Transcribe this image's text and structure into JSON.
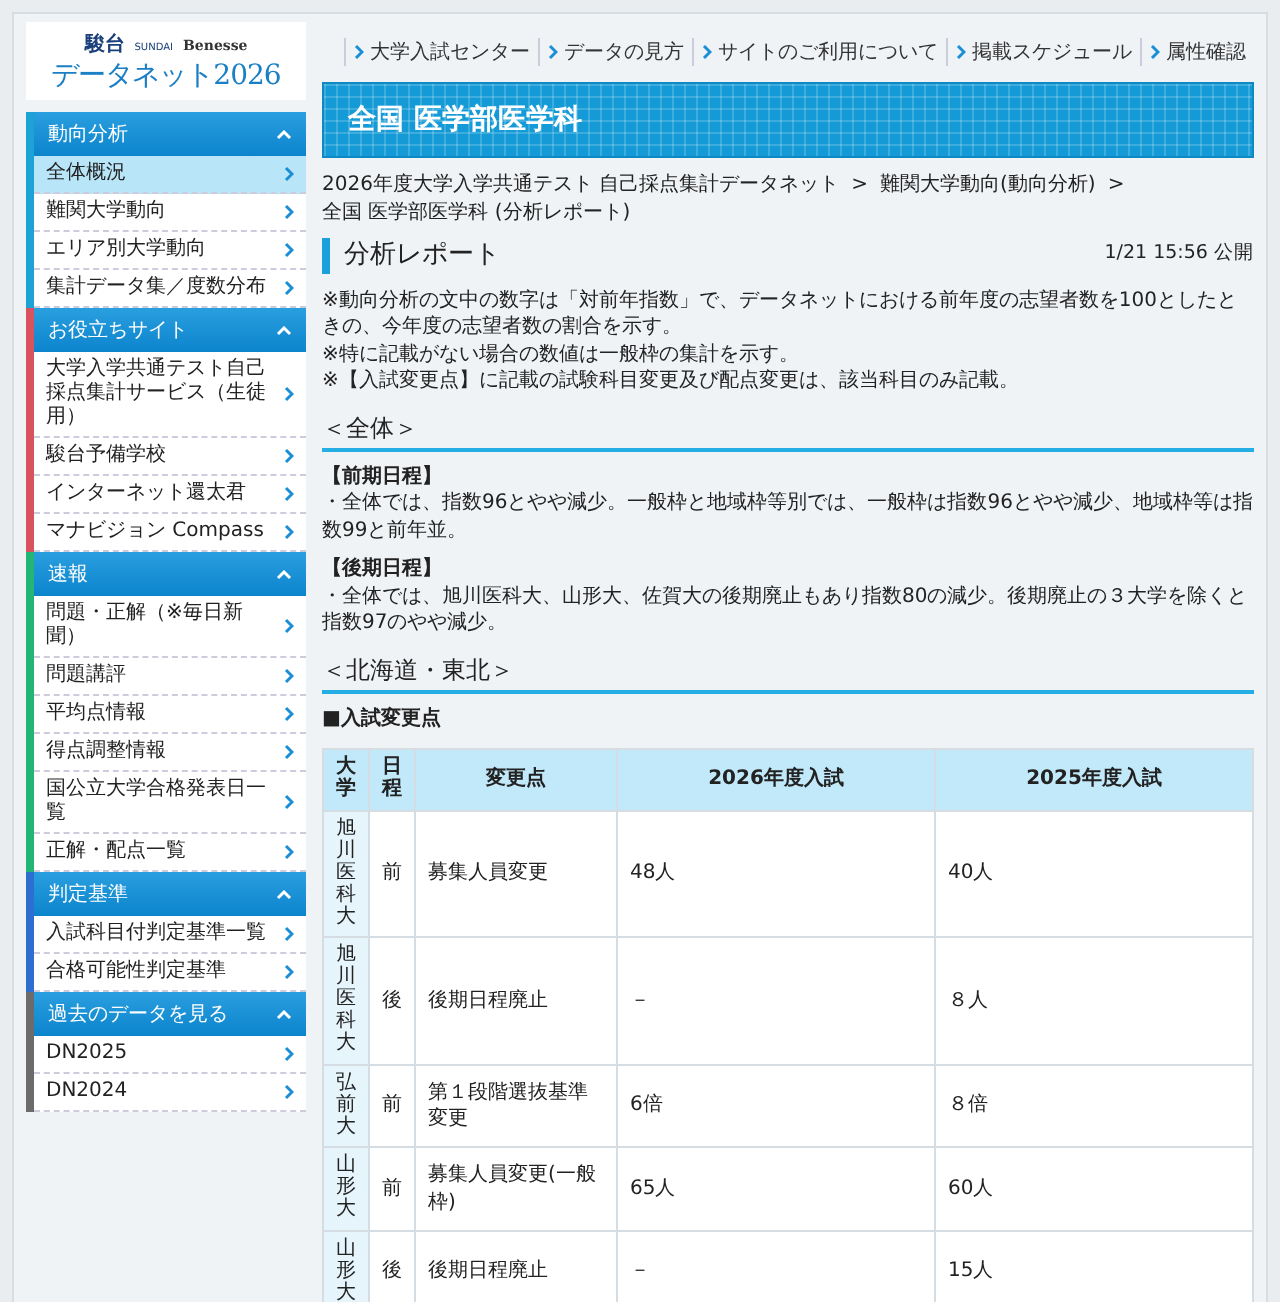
{
  "logo": {
    "brand": "駿台",
    "brand_sub": "SUNDAI",
    "partner": "Benesse",
    "title": "データネット2026"
  },
  "top_nav": [
    "大学入試センター",
    "データの見方",
    "サイトのご利用について",
    "掲載スケジュール",
    "属性確認"
  ],
  "sidebar": {
    "sections": [
      {
        "title": "動向分析",
        "color": "#1ba3d6",
        "expanded": true,
        "items": [
          {
            "label": "全体概況",
            "selected": true
          },
          {
            "label": "難関大学動向",
            "selected": false
          },
          {
            "label": "エリア別大学動向",
            "selected": false
          },
          {
            "label": "集計データ集／度数分布",
            "selected": false
          }
        ]
      },
      {
        "title": "お役立ちサイト",
        "color": "#d9535e",
        "expanded": true,
        "items": [
          {
            "label": "大学入学共通テスト自己採点集計サービス（生徒用）",
            "selected": false
          },
          {
            "label": "駿台予備学校",
            "selected": false
          },
          {
            "label": "インターネット還太君",
            "selected": false
          },
          {
            "label": "マナビジョン Compass",
            "selected": false
          }
        ]
      },
      {
        "title": "速報",
        "color": "#22b573",
        "expanded": true,
        "items": [
          {
            "label": "問題・正解（※毎日新聞）",
            "selected": false
          },
          {
            "label": "問題講評",
            "selected": false
          },
          {
            "label": "平均点情報",
            "selected": false
          },
          {
            "label": "得点調整情報",
            "selected": false
          },
          {
            "label": "国公立大学合格発表日一覧",
            "selected": false
          },
          {
            "label": "正解・配点一覧",
            "selected": false
          }
        ]
      },
      {
        "title": "判定基準",
        "color": "#2c6fd1",
        "expanded": true,
        "items": [
          {
            "label": "入試科目付判定基準一覧",
            "selected": false
          },
          {
            "label": "合格可能性判定基準",
            "selected": false
          }
        ]
      },
      {
        "title": "過去のデータを見る",
        "color": "#6b6b6b",
        "expanded": true,
        "items": [
          {
            "label": "DN2025",
            "selected": false
          },
          {
            "label": "DN2024",
            "selected": false
          }
        ]
      }
    ]
  },
  "banner": {
    "title": "全国 医学部医学科"
  },
  "breadcrumb": {
    "separator": ">",
    "items": [
      "2026年度大学入学共通テスト 自己採点集計データネット",
      "難関大学動向(動向分析)",
      "全国 医学部医学科 (分析レポート)"
    ]
  },
  "report": {
    "title": "分析レポート",
    "published": "1/21 15:56 公開",
    "notes": [
      "※動向分析の文中の数字は「対前年指数」で、データネットにおける前年度の志望者数を100としたときの、今年度の志望者数の割合を示す。",
      "※特に記載がない場合の数値は一般枠の集計を示す。",
      "※【入試変更点】に記載の試験科目変更及び配点変更は、該当科目のみ記載。"
    ],
    "sections": [
      {
        "heading": "＜全体＞",
        "blocks": [
          {
            "kind": "text",
            "title": "【前期日程】",
            "text": "・全体では、指数96とやや減少。一般枠と地域枠等別では、一般枠は指数96とやや減少、地域枠等は指数99と前年並。"
          },
          {
            "kind": "text",
            "title": "【後期日程】",
            "text": "・全体では、旭川医科大、山形大、佐賀大の後期廃止もあり指数80の減少。後期廃止の３大学を除くと指数97のやや減少。"
          }
        ]
      },
      {
        "heading": "＜北海道・東北＞",
        "blocks": [
          {
            "kind": "table",
            "title": "■入試変更点",
            "columns": [
              "大学",
              "日程",
              "変更点",
              "2026年度入試",
              "2025年度入試"
            ],
            "rows": [
              [
                "旭川医科大",
                "前",
                "募集人員変更",
                "48人",
                "40人"
              ],
              [
                "旭川医科大",
                "後",
                "後期日程廃止",
                "－",
                "８人"
              ],
              [
                "弘前大",
                "前",
                "第１段階選抜基準変更",
                "6倍",
                "８倍"
              ],
              [
                "山形大",
                "前",
                "募集人員変更(一般枠)",
                "65人",
                "60人"
              ],
              [
                "山形大",
                "後",
                "後期日程廃止",
                "－",
                "15人"
              ]
            ]
          }
        ]
      }
    ]
  }
}
